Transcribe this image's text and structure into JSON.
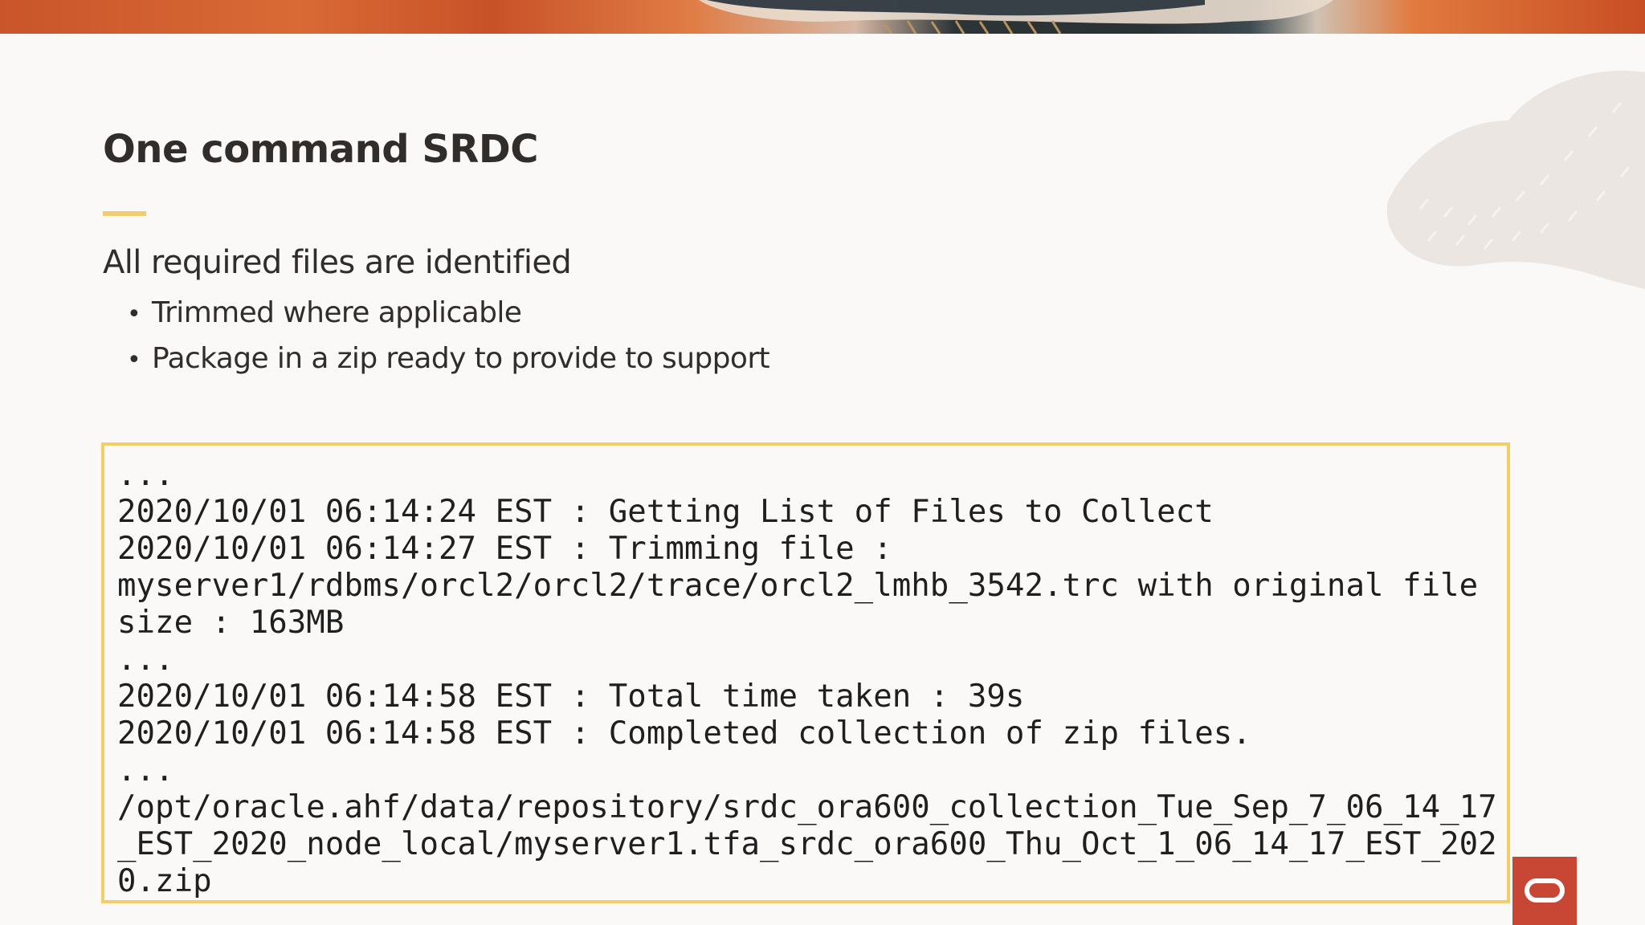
{
  "slide": {
    "title": "One command SRDC",
    "subheading": "All required files are identified",
    "bullets": [
      "Trimmed where applicable",
      "Package in a zip ready to provide to support"
    ]
  },
  "log": {
    "lines": [
      "...",
      "2020/10/01 06:14:24 EST : Getting List of Files to Collect",
      "2020/10/01 06:14:27 EST : Trimming file :",
      "myserver1/rdbms/orcl2/orcl2/trace/orcl2_lmhb_3542.trc with original file",
      "size : 163MB",
      "...",
      "2020/10/01 06:14:58 EST : Total time taken : 39s",
      "2020/10/01 06:14:58 EST : Completed collection of zip files.",
      "...",
      "/opt/oracle.ahf/data/repository/srdc_ora600_collection_Tue_Sep_7_06_14_17",
      "_EST_2020_node_local/myserver1.tfa_srdc_ora600_Thu_Oct_1_06_14_17_EST_202",
      "0.zip"
    ]
  },
  "colors": {
    "accent": "#f0cc71",
    "log_border": "#f2cd68",
    "brand_red": "#c74634",
    "text": "#312d2a"
  },
  "icons": {
    "brand_logo": "oracle-logo-icon",
    "bullet": "bullet-dot-icon"
  }
}
